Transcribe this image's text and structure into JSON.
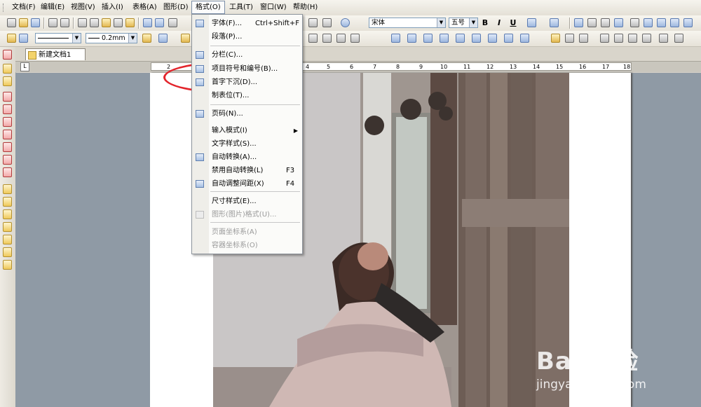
{
  "menubar": {
    "items": [
      "文档(F)",
      "编辑(E)",
      "视图(V)",
      "插入(I)",
      "表格(A)",
      "图形(D)",
      "格式(O)",
      "工具(T)",
      "窗口(W)",
      "帮助(H)"
    ]
  },
  "toolbar": {
    "font_name": "宋体",
    "font_size": "五号",
    "line_width": "0.2mm",
    "bold": "B",
    "italic": "I",
    "underline": "U"
  },
  "tab": {
    "title": "新建文档1"
  },
  "ruler": {
    "numbers": [
      "2",
      "4",
      "5",
      "6",
      "7",
      "8",
      "9",
      "10",
      "11",
      "12",
      "13",
      "14",
      "15",
      "16",
      "17",
      "18"
    ]
  },
  "format_menu": {
    "items": [
      {
        "label": "字体(F)...",
        "shortcut": "Ctrl+Shift+F",
        "icon": "font-icon",
        "disabled": false
      },
      {
        "label": "段落(P)...",
        "shortcut": "",
        "icon": "",
        "disabled": false
      },
      {
        "label": "分栏(C)...",
        "shortcut": "",
        "icon": "columns-icon",
        "disabled": false
      },
      {
        "label": "项目符号和编号(B)...",
        "shortcut": "",
        "icon": "bullets-icon",
        "disabled": false
      },
      {
        "label": "首字下沉(D)...",
        "shortcut": "",
        "icon": "drop-cap-icon",
        "disabled": false
      },
      {
        "label": "制表位(T)...",
        "shortcut": "",
        "icon": "",
        "disabled": false
      },
      {
        "label": "页码(N)...",
        "shortcut": "",
        "icon": "page-number-icon",
        "disabled": false
      },
      {
        "label": "输入模式(I)",
        "shortcut": "",
        "icon": "",
        "disabled": false,
        "submenu": true
      },
      {
        "label": "文字样式(S)...",
        "shortcut": "",
        "icon": "",
        "disabled": false
      },
      {
        "label": "自动转换(A)...",
        "shortcut": "",
        "icon": "auto-convert-icon",
        "disabled": false
      },
      {
        "label": "禁用自动转换(L)",
        "shortcut": "F3",
        "icon": "",
        "disabled": false
      },
      {
        "label": "自动调整间距(X)",
        "shortcut": "F4",
        "icon": "auto-spacing-icon",
        "disabled": false
      },
      {
        "label": "尺寸样式(E)...",
        "shortcut": "",
        "icon": "",
        "disabled": false
      },
      {
        "label": "图形(图片)格式(U)...",
        "shortcut": "",
        "icon": "graphic-format-icon",
        "disabled": true
      },
      {
        "label": "页面坐标系(A)",
        "shortcut": "",
        "icon": "",
        "disabled": true
      },
      {
        "label": "容器坐标系(O)",
        "shortcut": "",
        "icon": "",
        "disabled": true
      }
    ]
  },
  "watermark": {
    "logo": "Bai 经验",
    "url": "jingyan.baidu.com"
  }
}
